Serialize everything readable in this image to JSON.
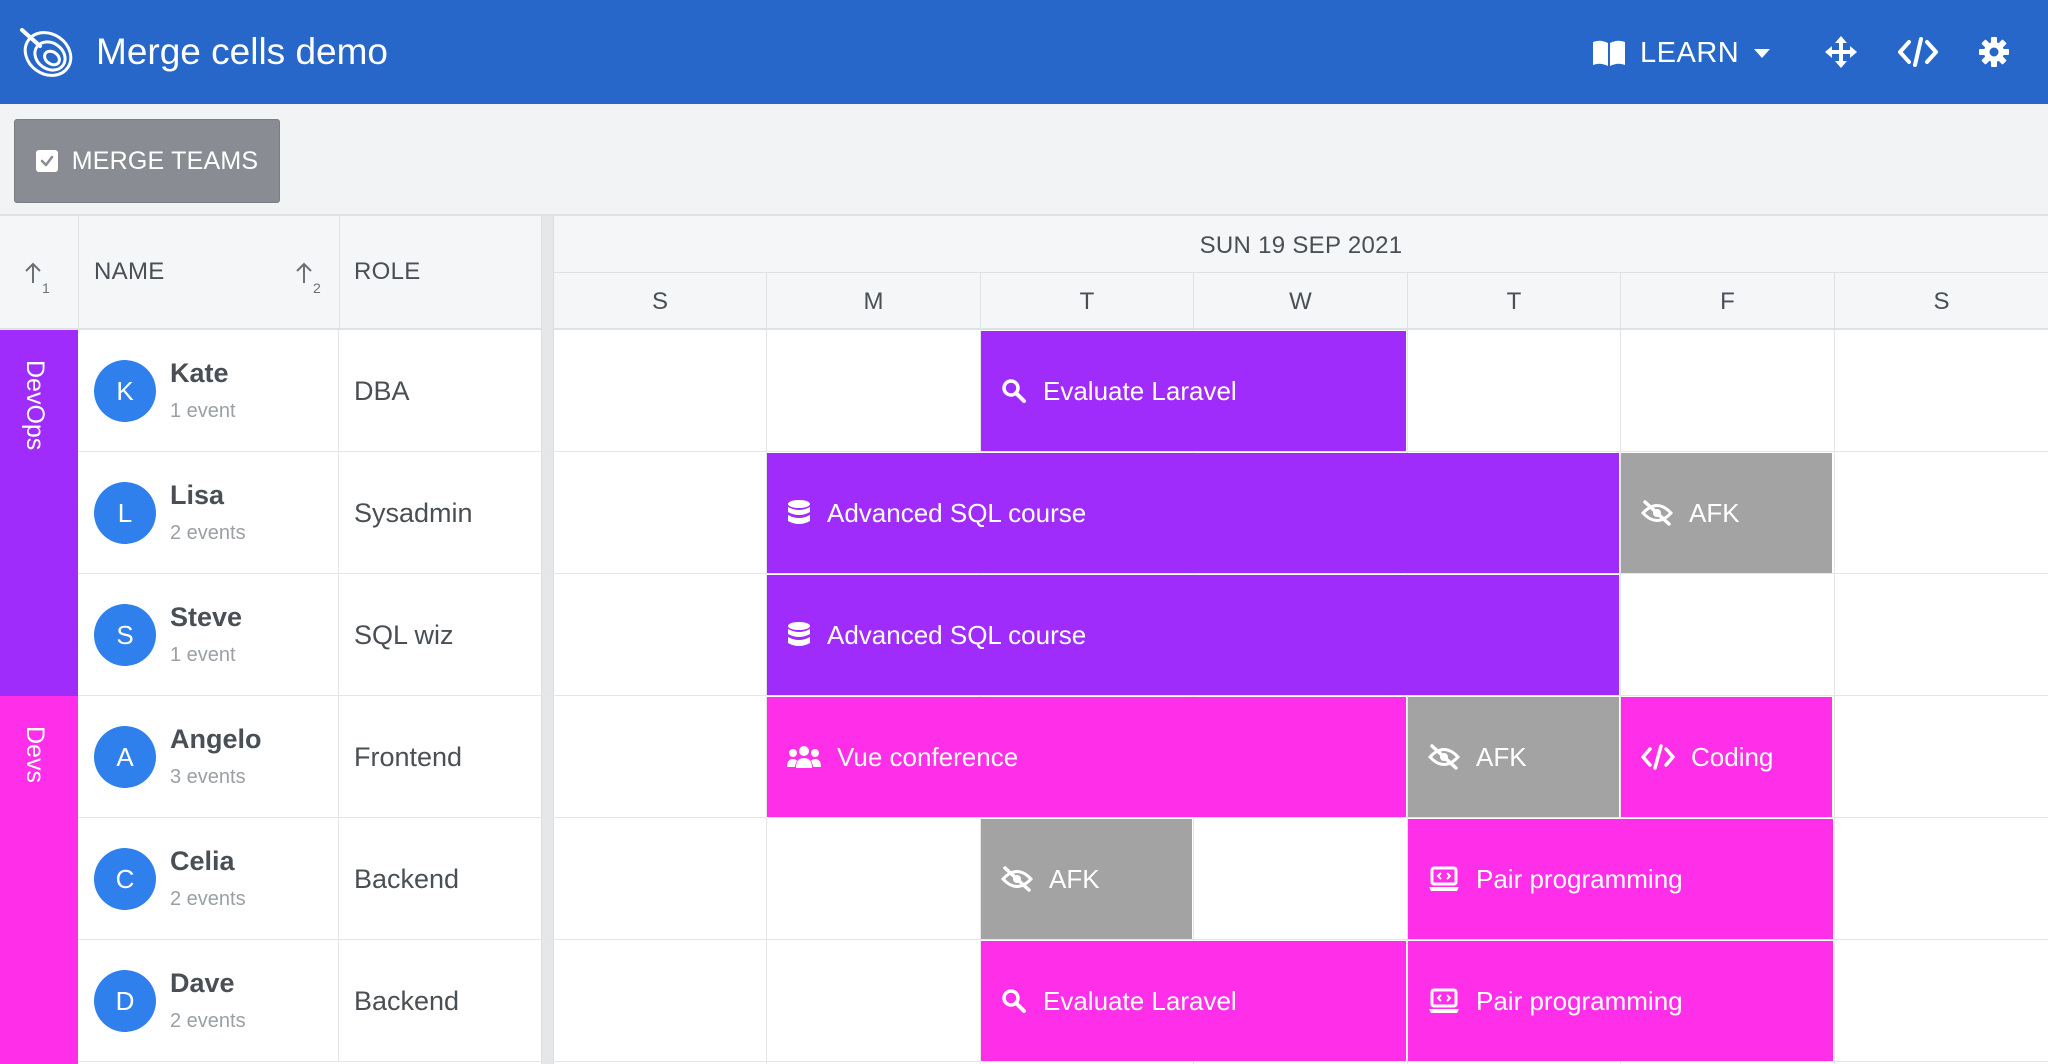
{
  "header": {
    "title": "Merge cells demo",
    "learn_label": "LEARN"
  },
  "toolbar": {
    "merge_label": "MERGE TEAMS"
  },
  "columns": {
    "sort_index_1": "1",
    "name_label": "NAME",
    "sort_index_2": "2",
    "role_label": "ROLE",
    "date": "SUN 19 SEP 2021",
    "days": [
      "S",
      "M",
      "T",
      "W",
      "T",
      "F",
      "S"
    ]
  },
  "groups": [
    {
      "name": "DevOps",
      "color": "#a02cfb"
    },
    {
      "name": "Devs",
      "color": "#ff2ee8"
    }
  ],
  "rows": [
    {
      "initial": "K",
      "name": "Kate",
      "events": "1 event",
      "role": "DBA"
    },
    {
      "initial": "L",
      "name": "Lisa",
      "events": "2 events",
      "role": "Sysadmin"
    },
    {
      "initial": "S",
      "name": "Steve",
      "events": "1 event",
      "role": "SQL wiz"
    },
    {
      "initial": "A",
      "name": "Angelo",
      "events": "3 events",
      "role": "Frontend"
    },
    {
      "initial": "C",
      "name": "Celia",
      "events": "2 events",
      "role": "Backend"
    },
    {
      "initial": "D",
      "name": "Dave",
      "events": "2 events",
      "role": "Backend"
    }
  ],
  "events": {
    "kate_laravel": "Evaluate Laravel",
    "lisa_sql": "Advanced SQL course",
    "lisa_afk": "AFK",
    "steve_sql": "Advanced SQL course",
    "angelo_vue": "Vue conference",
    "angelo_afk": "AFK",
    "angelo_coding": "Coding",
    "celia_afk": "AFK",
    "celia_pair": "Pair programming",
    "dave_laravel": "Evaluate Laravel",
    "dave_pair": "Pair programming"
  },
  "icons": {
    "search": "search-icon",
    "database": "database-icon",
    "afk": "eye-slash-icon",
    "users": "users-icon",
    "code": "code-icon",
    "laptop": "laptop-code-icon"
  },
  "colors": {
    "header": "#2667c9",
    "devops_event": "#a02cfb",
    "devs_event": "#ff2ee8",
    "afk_event": "#a3a3a3",
    "avatar": "#2f80ed"
  }
}
